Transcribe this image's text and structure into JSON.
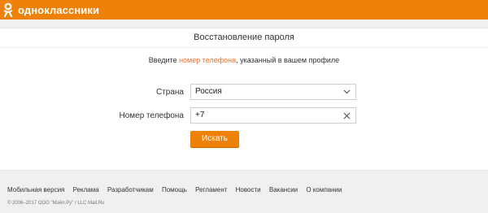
{
  "header": {
    "logo_text": "одноклассники",
    "brand_color": "#ee8208"
  },
  "page": {
    "title": "Восстановление пароля",
    "instruction_before": "Введите ",
    "instruction_link": "номер телефона",
    "instruction_after": ", указанный в вашем профиле"
  },
  "form": {
    "country_label": "Страна",
    "country_value": "Россия",
    "phone_label": "Номер телефона",
    "phone_value": "+7",
    "search_button": "Искать"
  },
  "footer": {
    "links": [
      "Мобильная версия",
      "Реклама",
      "Разработчикам",
      "Помощь",
      "Регламент",
      "Новости",
      "Вакансии",
      "О компании"
    ],
    "copyright": "© 2006–2017 ООО \"Мэйл.Ру\" / LLC Mail.Ru"
  },
  "icons": {
    "logo": "ok-logo-icon",
    "dropdown": "chevron-down-icon",
    "clear": "close-icon"
  }
}
